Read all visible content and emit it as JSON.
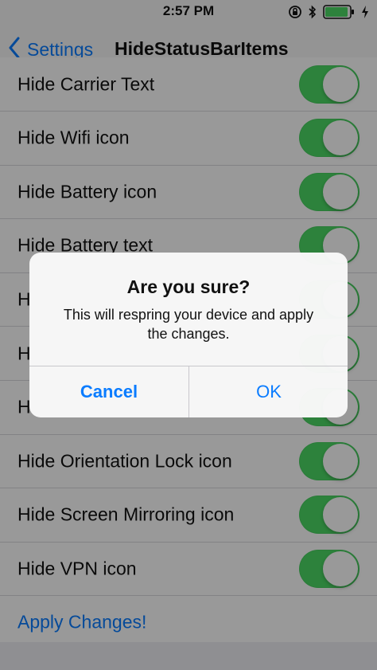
{
  "status_bar": {
    "time": "2:57 PM",
    "icons": [
      "orientation-lock-icon",
      "bluetooth-icon",
      "battery-icon",
      "charging-bolt-icon"
    ],
    "battery_color": "#4bd964"
  },
  "nav": {
    "back_label": "Settings",
    "title": "HideStatusBarItems"
  },
  "list": {
    "rows": [
      {
        "label": "Hide Carrier Text",
        "on": true
      },
      {
        "label": "Hide Wifi icon",
        "on": true
      },
      {
        "label": "Hide Battery icon",
        "on": true
      },
      {
        "label": "Hide Battery text",
        "on": true
      },
      {
        "label": "H",
        "on": true
      },
      {
        "label": "H",
        "on": true
      },
      {
        "label": "H",
        "on": true
      },
      {
        "label": "Hide Orientation Lock icon",
        "on": true
      },
      {
        "label": "Hide Screen Mirroring icon",
        "on": true
      },
      {
        "label": "Hide VPN icon",
        "on": true
      }
    ],
    "apply_label": "Apply Changes!"
  },
  "alert": {
    "title": "Are you sure?",
    "message": "This will respring your device and apply the changes.",
    "cancel_label": "Cancel",
    "ok_label": "OK"
  },
  "colors": {
    "accent": "#0a7cff",
    "toggle_on": "#4bd964"
  }
}
